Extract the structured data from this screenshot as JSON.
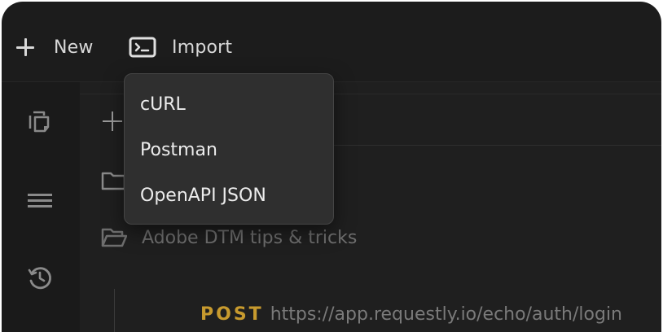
{
  "toolbar": {
    "new_label": "New",
    "import_label": "Import"
  },
  "sidebar": {
    "icons": [
      "copy-icon",
      "list-icon",
      "history-icon"
    ]
  },
  "collections": {
    "folders": [
      {
        "label": "",
        "icon": "folder-icon"
      },
      {
        "label": "Adobe DTM tips & tricks",
        "icon": "folder-open-icon"
      }
    ]
  },
  "request": {
    "method": "POST",
    "url": "https://app.requestly.io/echo/auth/login"
  },
  "import_menu": {
    "items": [
      {
        "label": "cURL"
      },
      {
        "label": "Postman"
      },
      {
        "label": "OpenAPI JSON"
      }
    ]
  },
  "colors": {
    "background": "#1c1c1c",
    "menu_bg": "#2f2f2f",
    "method_post": "#c79a2e"
  }
}
